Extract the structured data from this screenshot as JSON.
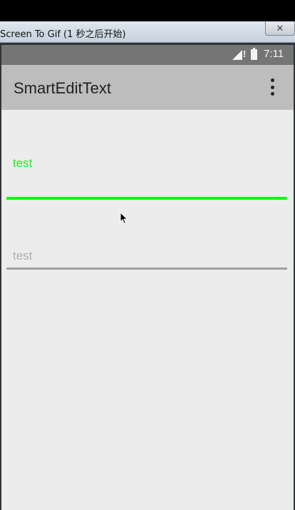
{
  "recorder_window": {
    "title": "Screen To Gif (1 秒之后开始)",
    "close_glyph": "✕"
  },
  "status_bar": {
    "time": "7:11",
    "alert_glyph": "!",
    "icons": [
      "signal-icon",
      "battery-icon"
    ]
  },
  "app_bar": {
    "title": "SmartEditText",
    "overflow_icon": "more-vert-icon"
  },
  "fields": [
    {
      "value": "test",
      "state": "focused",
      "underline_color": "#00ff00",
      "text_color": "#22ee22"
    },
    {
      "value": "test",
      "state": "unfocused",
      "underline_color": "#a0a0a0",
      "text_color": "#b0b0b0"
    }
  ],
  "colors": {
    "status_bar": "#757575",
    "app_bar": "#bdbdbd",
    "background": "#ececec"
  }
}
